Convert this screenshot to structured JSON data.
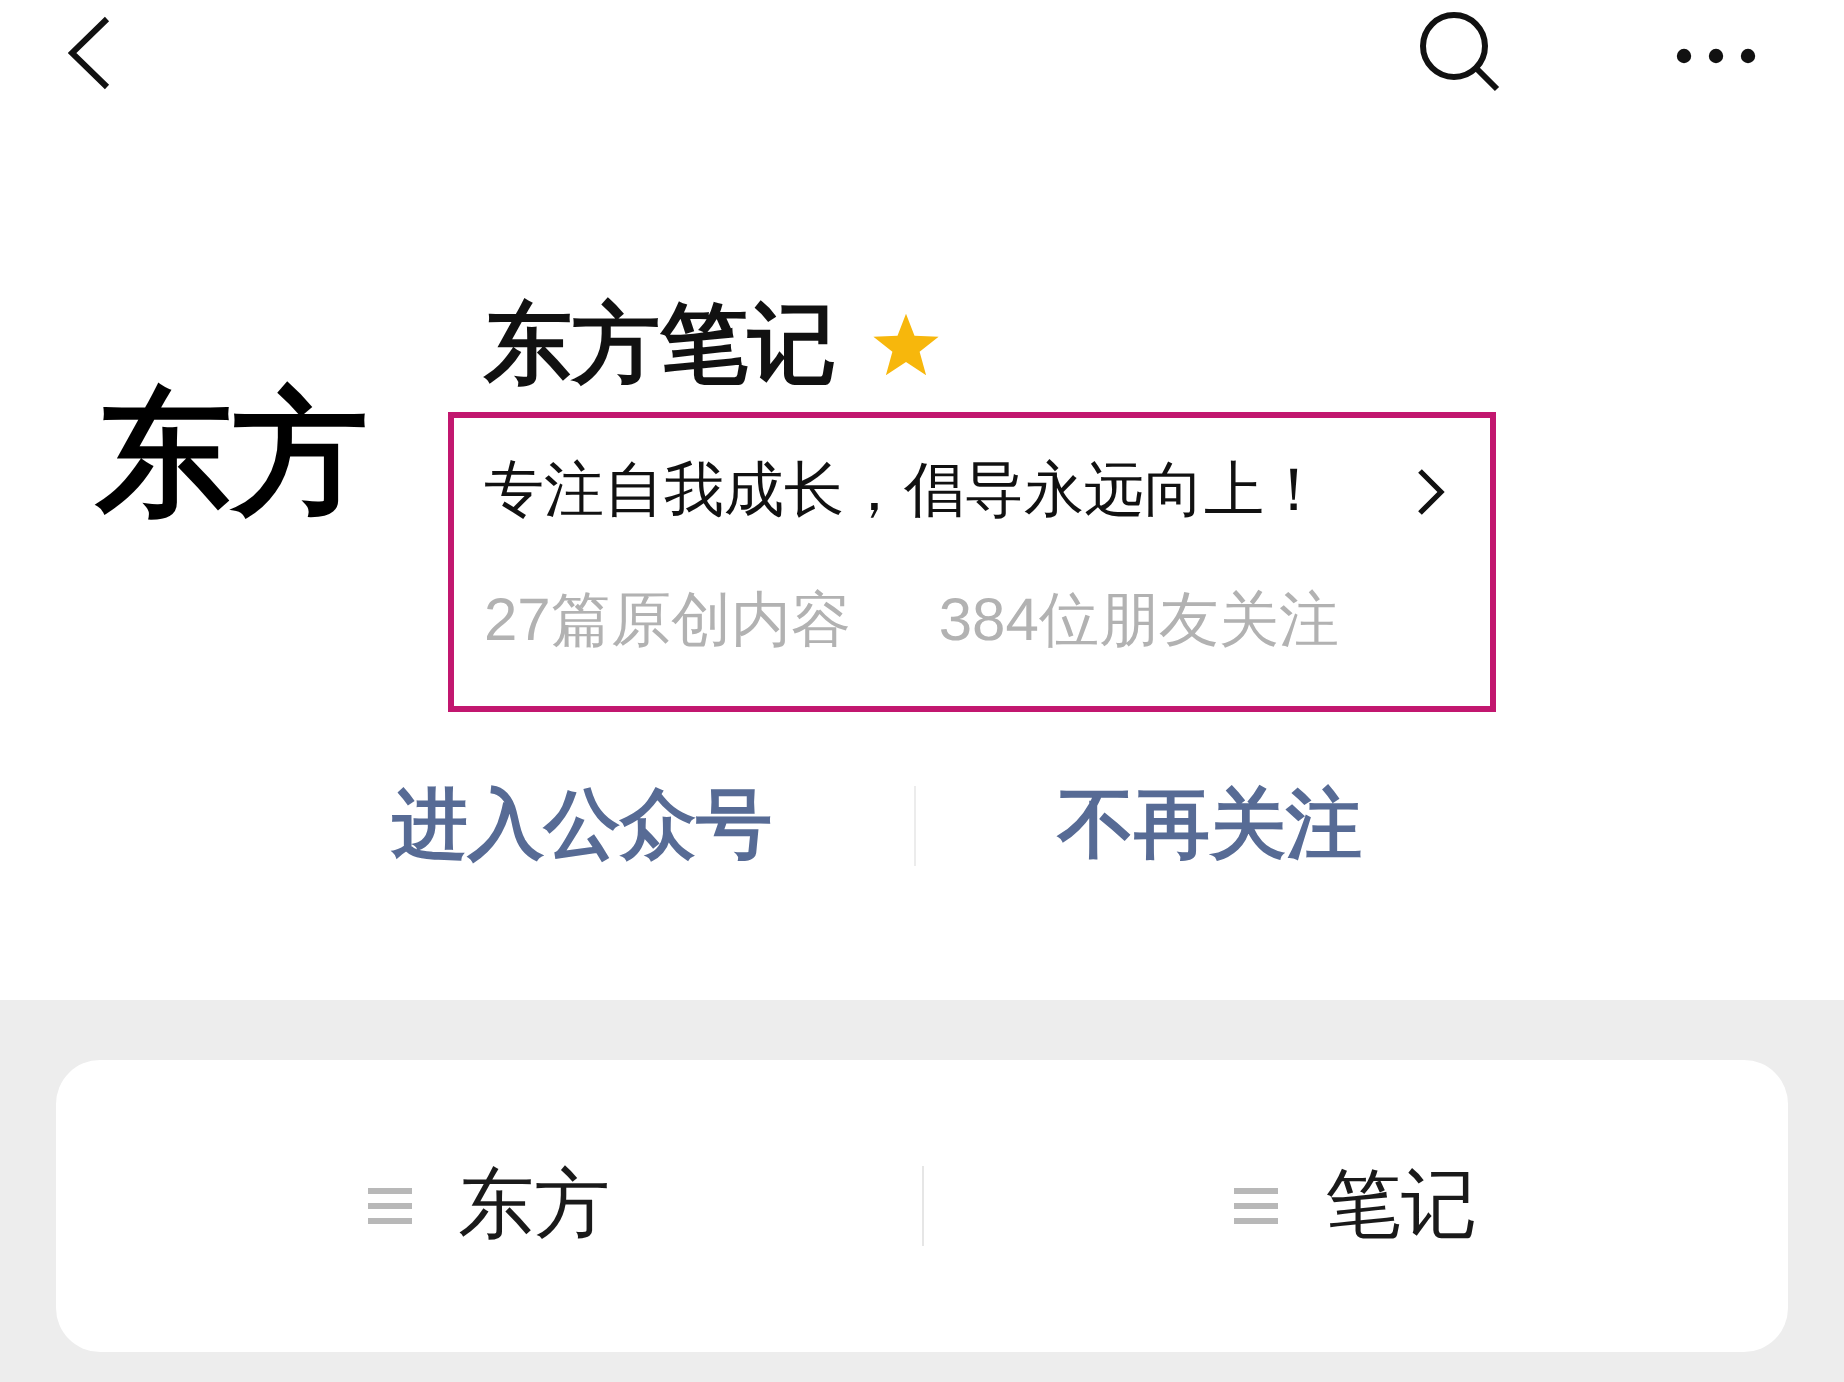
{
  "account": {
    "logo_text": "东方",
    "name": "东方笔记",
    "starred": true
  },
  "profile_info": {
    "highlighted": true,
    "description": "专注自我成长，倡导永远向上！",
    "stats": [
      "27篇原创内容",
      "384位朋友关注"
    ]
  },
  "actions": [
    {
      "label": "进入公众号"
    },
    {
      "label": "不再关注"
    }
  ],
  "menu": [
    {
      "label": "东方"
    },
    {
      "label": "笔记"
    }
  ]
}
